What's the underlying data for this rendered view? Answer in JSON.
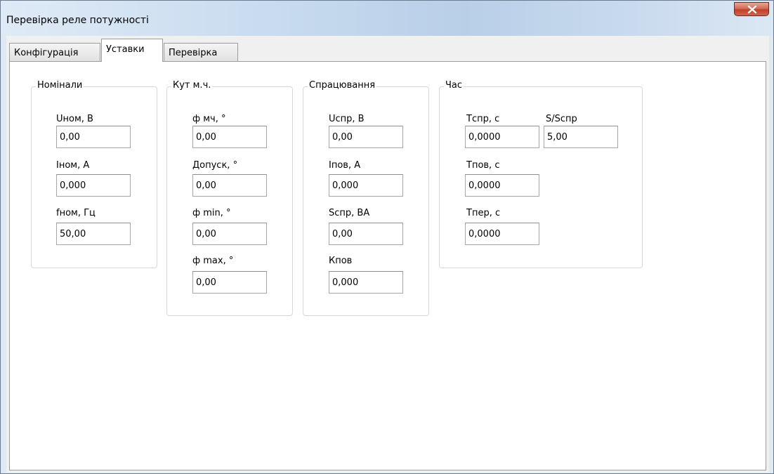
{
  "window": {
    "title": "Перевірка реле потужності"
  },
  "tabs": [
    {
      "label": "Конфігурація",
      "active": false
    },
    {
      "label": "Уставки",
      "active": true
    },
    {
      "label": "Перевірка",
      "active": false
    }
  ],
  "groups": {
    "nominals": {
      "title": "Номінали",
      "u_nom": {
        "label": "Uном, В",
        "value": "0,00"
      },
      "i_nom": {
        "label": "Iном, А",
        "value": "0,000"
      },
      "f_nom": {
        "label": "fном, Гц",
        "value": "50,00"
      }
    },
    "angle": {
      "title": "Кут м.ч.",
      "phi_mch": {
        "label": "ф мч, °",
        "value": "0,00"
      },
      "tolerance": {
        "label": "Допуск, °",
        "value": "0,00"
      },
      "phi_min": {
        "label": "ф min, °",
        "value": "0,00"
      },
      "phi_max": {
        "label": "ф max, °",
        "value": "0,00"
      }
    },
    "operation": {
      "title": "Спрацювання",
      "u_spr": {
        "label": "Uспр, В",
        "value": "0,00"
      },
      "i_pov": {
        "label": "Iпов, А",
        "value": "0,000"
      },
      "s_spr": {
        "label": "Sспр, ВА",
        "value": "0,00"
      },
      "k_pov": {
        "label": "Кпов",
        "value": "0,000"
      }
    },
    "time": {
      "title": "Час",
      "t_spr": {
        "label": "Тспр, с",
        "value": "0,0000"
      },
      "s_ratio": {
        "label": "S/Sспр",
        "value": "5,00"
      },
      "t_pov": {
        "label": "Тпов, с",
        "value": "0,0000"
      },
      "t_per": {
        "label": "Тпер, с",
        "value": "0,0000"
      }
    }
  },
  "icons": {
    "close": "close-icon"
  }
}
